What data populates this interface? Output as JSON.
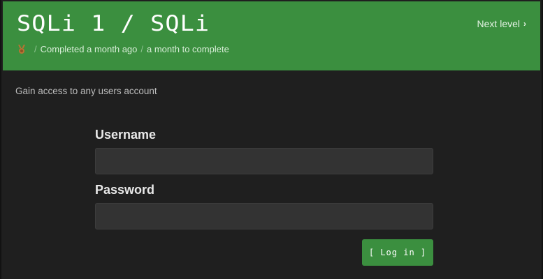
{
  "header": {
    "title": "SQLi 1 / SQLi",
    "medal_icon": "bronze-medal-icon",
    "medal_color": "#b87333",
    "status": "Completed a month ago",
    "duration": "a month to complete",
    "separator": "/",
    "next_level": "Next level",
    "background": "#3b8f3f"
  },
  "main": {
    "description": "Gain access to any users account"
  },
  "form": {
    "username_label": "Username",
    "username_value": "",
    "password_label": "Password",
    "password_value": "",
    "login_label": "[ Log in ]"
  }
}
